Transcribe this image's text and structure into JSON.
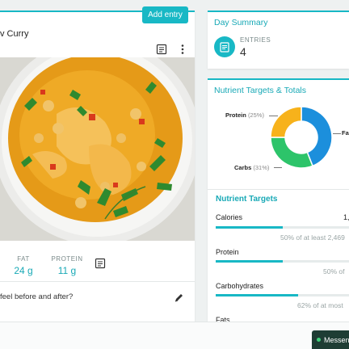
{
  "left_card": {
    "add_entry_label": "Add entry",
    "entry_title": "v Curry",
    "macros": [
      {
        "label": "FAT",
        "value": "24 g"
      },
      {
        "label": "PROTEIN",
        "value": "11 g"
      }
    ],
    "question": "feel before and after?"
  },
  "summary": {
    "title": "Day Summary",
    "entries_label": "ENTRIES",
    "entries_value": "4"
  },
  "nutrients": {
    "title": "Nutrient Targets & Totals",
    "legend": [
      {
        "name": "Protein",
        "pct": "(25%)"
      },
      {
        "name": "Carbs",
        "pct": "(31%)"
      },
      {
        "name": "Fa",
        "pct": ""
      }
    ],
    "targets_title": "Nutrient Targets",
    "rows": [
      {
        "label": "Calories",
        "right": "1,",
        "note": "50% of at least 2,469",
        "fill": 0.5
      },
      {
        "label": "Protein",
        "right": "",
        "note": "50% of",
        "fill": 0.5
      },
      {
        "label": "Carbohydrates",
        "right": "",
        "note": "62% of at most",
        "fill": 0.62
      },
      {
        "label": "Fats",
        "right": "",
        "note": "",
        "fill": 0
      }
    ]
  },
  "chart_data": {
    "type": "pie",
    "categories": [
      "Fat",
      "Carbs",
      "Protein"
    ],
    "values": [
      44,
      31,
      25
    ],
    "colors": [
      "#1c8fdc",
      "#2dc46a",
      "#f7b21b"
    ]
  },
  "messenger": {
    "label": "Messen"
  },
  "icons": {
    "notes": "notes-icon",
    "more": "more-vert-icon",
    "edit": "pencil-icon",
    "entries": "list-icon"
  }
}
